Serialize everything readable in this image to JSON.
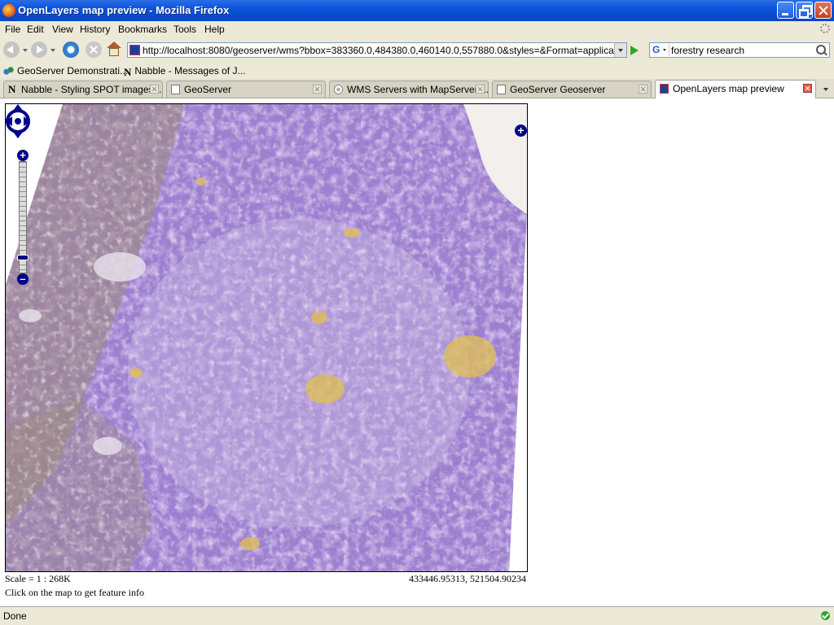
{
  "window": {
    "title": "OpenLayers map preview - Mozilla Firefox"
  },
  "menu": {
    "items": [
      "File",
      "Edit",
      "View",
      "History",
      "Bookmarks",
      "Tools",
      "Help"
    ]
  },
  "nav": {
    "url": "http://localhost:8080/geoserver/wms?bbox=383360.0,484380.0,460140.0,557880.0&styles=&Format=application/openlayers",
    "search_engine": "G",
    "search_value": "forestry research"
  },
  "bookmarks": [
    "GeoServer Demonstrati...",
    "Nabble - Messages of J..."
  ],
  "tabs": [
    {
      "label": "Nabble - Styling SPOT images ...",
      "icon": "nabble-icon",
      "active": false
    },
    {
      "label": "GeoServer",
      "icon": "page-icon",
      "active": false
    },
    {
      "label": "WMS Servers with MapServer ...",
      "icon": "wms-icon",
      "active": false
    },
    {
      "label": "GeoServer Geoserver",
      "icon": "page-icon",
      "active": false
    },
    {
      "label": "OpenLayers map preview",
      "icon": "openlayers-icon",
      "active": true
    }
  ],
  "map": {
    "zoom_in": "+",
    "zoom_out": "–",
    "layer_switcher": "+",
    "zoom_level_fraction": 0.88
  },
  "footer": {
    "scale": "Scale = 1 : 268K",
    "coords": "433446.95313, 521504.90234",
    "hint": "Click on the map to get feature info"
  },
  "status": {
    "text": "Done"
  },
  "colors": {
    "imagery_base": "#9d7fcf",
    "imagery_light": "#c6b6e0",
    "imagery_brown": "#9c8a78",
    "imagery_yellow": "#e0c050",
    "nav_control": "#00008b"
  }
}
